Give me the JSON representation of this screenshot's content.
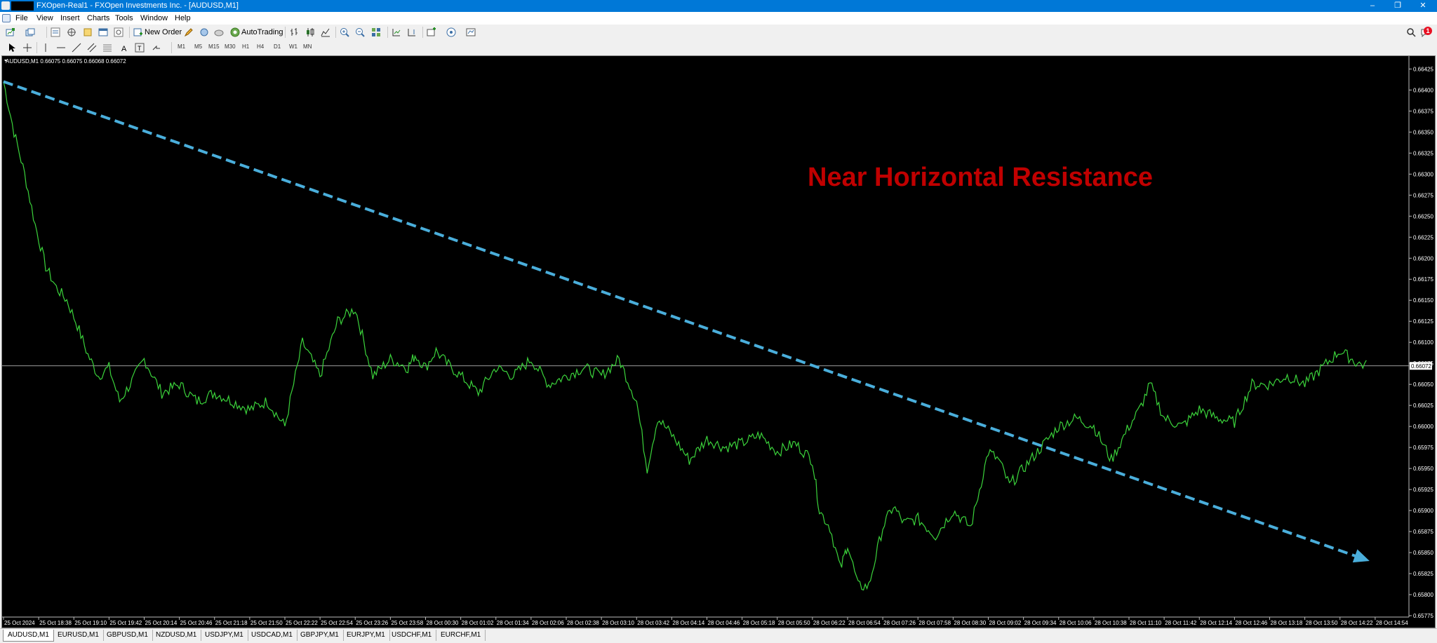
{
  "window": {
    "title": "FXOpen-Real1 - FXOpen Investments Inc. - [AUDUSD,M1]",
    "controls": [
      "–",
      "❐",
      "✕"
    ]
  },
  "menu": [
    "File",
    "View",
    "Insert",
    "Charts",
    "Tools",
    "Window",
    "Help"
  ],
  "toolbar": {
    "new_order": "New Order",
    "autotrading": "AutoTrading",
    "notification_count": "1"
  },
  "timeframes": [
    "M1",
    "M5",
    "M15",
    "M30",
    "H1",
    "H4",
    "D1",
    "W1",
    "MN"
  ],
  "chart_header": "AUDUSD,M1  0.66075 0.66075 0.66068 0.66072",
  "annotation": "Near Horizontal Resistance",
  "current_price_label": "0.66072",
  "tabs": [
    "AUDUSD,M1",
    "EURUSD,M1",
    "GBPUSD,M1",
    "NZDUSD,M1",
    "USDJPY,M1",
    "USDCAD,M1",
    "GBPJPY,M1",
    "EURJPY,M1",
    "USDCHF,M1",
    "EURCHF,M1"
  ],
  "colors": {
    "price_line": "#3bd33b",
    "trendline": "#4aaedb",
    "annotation": "#c00000",
    "background": "#000000",
    "horizontal_line": "#d0d0d0"
  },
  "chart_data": {
    "type": "line",
    "symbol": "AUDUSD",
    "timeframe": "M1",
    "ohlc": {
      "open": 0.66075,
      "high": 0.66075,
      "low": 0.66068,
      "close": 0.66072
    },
    "price_ticks": [
      "0.66425",
      "0.66400",
      "0.66375",
      "0.66350",
      "0.66325",
      "0.66300",
      "0.66275",
      "0.66250",
      "0.66225",
      "0.66200",
      "0.66175",
      "0.66150",
      "0.66125",
      "0.66100",
      "0.66075",
      "0.66050",
      "0.66025",
      "0.66000",
      "0.65975",
      "0.65950",
      "0.65925",
      "0.65900",
      "0.65875",
      "0.65850",
      "0.65825",
      "0.65800",
      "0.65775"
    ],
    "time_ticks": [
      "25 Oct 2024",
      "25 Oct 18:38",
      "25 Oct 19:10",
      "25 Oct 19:42",
      "25 Oct 20:14",
      "25 Oct 20:46",
      "25 Oct 21:18",
      "25 Oct 21:50",
      "25 Oct 22:22",
      "25 Oct 22:54",
      "25 Oct 23:26",
      "25 Oct 23:58",
      "28 Oct 00:30",
      "28 Oct 01:02",
      "28 Oct 01:34",
      "28 Oct 02:06",
      "28 Oct 02:38",
      "28 Oct 03:10",
      "28 Oct 03:42",
      "28 Oct 04:14",
      "28 Oct 04:46",
      "28 Oct 05:18",
      "28 Oct 05:50",
      "28 Oct 06:22",
      "28 Oct 06:54",
      "28 Oct 07:26",
      "28 Oct 07:58",
      "28 Oct 08:30",
      "28 Oct 09:02",
      "28 Oct 09:34",
      "28 Oct 10:06",
      "28 Oct 10:38",
      "28 Oct 11:10",
      "28 Oct 11:42",
      "28 Oct 12:14",
      "28 Oct 12:46",
      "28 Oct 13:18",
      "28 Oct 13:50",
      "28 Oct 14:22",
      "28 Oct 14:54"
    ],
    "ylim": [
      0.65775,
      0.66437
    ],
    "series": [
      {
        "x_tick_pos": [
          0,
          0.3,
          0.6,
          0.9,
          1.2,
          1.5,
          1.8,
          2.1,
          2.4,
          2.7,
          3.0,
          3.3,
          3.6,
          4.0,
          4.5,
          5.0,
          5.5,
          6.0,
          6.5,
          7.0,
          7.5,
          8.0,
          8.5,
          9.0,
          9.5,
          10.0,
          10.5,
          11.0,
          11.5,
          11.7,
          12.0,
          12.3,
          12.6,
          13.0,
          13.5,
          14.0,
          14.5,
          15.0,
          15.5,
          16.0,
          16.5,
          17.0,
          17.5,
          18.0,
          18.3,
          18.6,
          19.0,
          19.5,
          20.0,
          20.5,
          21.0,
          21.5,
          22.0,
          22.5,
          23.0,
          23.2,
          23.5,
          23.8,
          24.0,
          24.3,
          24.6,
          25.0,
          25.3,
          25.6,
          26.0,
          26.5,
          27.0,
          27.5,
          28.0,
          28.3,
          28.6,
          29.0,
          29.5,
          30.0,
          30.5,
          31.0,
          31.5,
          32.0,
          32.3,
          32.6,
          33.0,
          33.5,
          34.0,
          34.5,
          35.0,
          35.5,
          36.0,
          36.5,
          37.0,
          37.5,
          38.0,
          38.5,
          38.8,
          39.0
        ],
        "y": [
          0.6641,
          0.6635,
          0.663,
          0.6624,
          0.6619,
          0.66165,
          0.6615,
          0.6612,
          0.66085,
          0.6606,
          0.6607,
          0.6603,
          0.6605,
          0.6608,
          0.6604,
          0.6605,
          0.6603,
          0.6604,
          0.6603,
          0.6602,
          0.6603,
          0.66,
          0.661,
          0.6606,
          0.66125,
          0.6614,
          0.6606,
          0.6608,
          0.6607,
          0.66085,
          0.6607,
          0.6609,
          0.66075,
          0.6606,
          0.6604,
          0.6607,
          0.6606,
          0.6608,
          0.6605,
          0.6606,
          0.6607,
          0.6606,
          0.6608,
          0.6603,
          0.6595,
          0.6601,
          0.6599,
          0.6596,
          0.65985,
          0.65975,
          0.6598,
          0.6599,
          0.6597,
          0.6598,
          0.6596,
          0.659,
          0.6588,
          0.6583,
          0.6586,
          0.6581,
          0.6581,
          0.6588,
          0.65905,
          0.65885,
          0.6589,
          0.6587,
          0.659,
          0.6588,
          0.6597,
          0.6596,
          0.6593,
          0.6595,
          0.65975,
          0.66,
          0.6601,
          0.66,
          0.6596,
          0.66,
          0.6602,
          0.6605,
          0.6601,
          0.66,
          0.6602,
          0.6601,
          0.66005,
          0.6605,
          0.6605,
          0.6606,
          0.6605,
          0.6607,
          0.6609,
          0.66075,
          0.66072
        ]
      }
    ],
    "horizontal_line": 0.66072,
    "trendline": {
      "from": [
        "25 Oct 2024",
        0.6641
      ],
      "to": [
        "28 Oct 14:54",
        0.6584
      ]
    }
  }
}
